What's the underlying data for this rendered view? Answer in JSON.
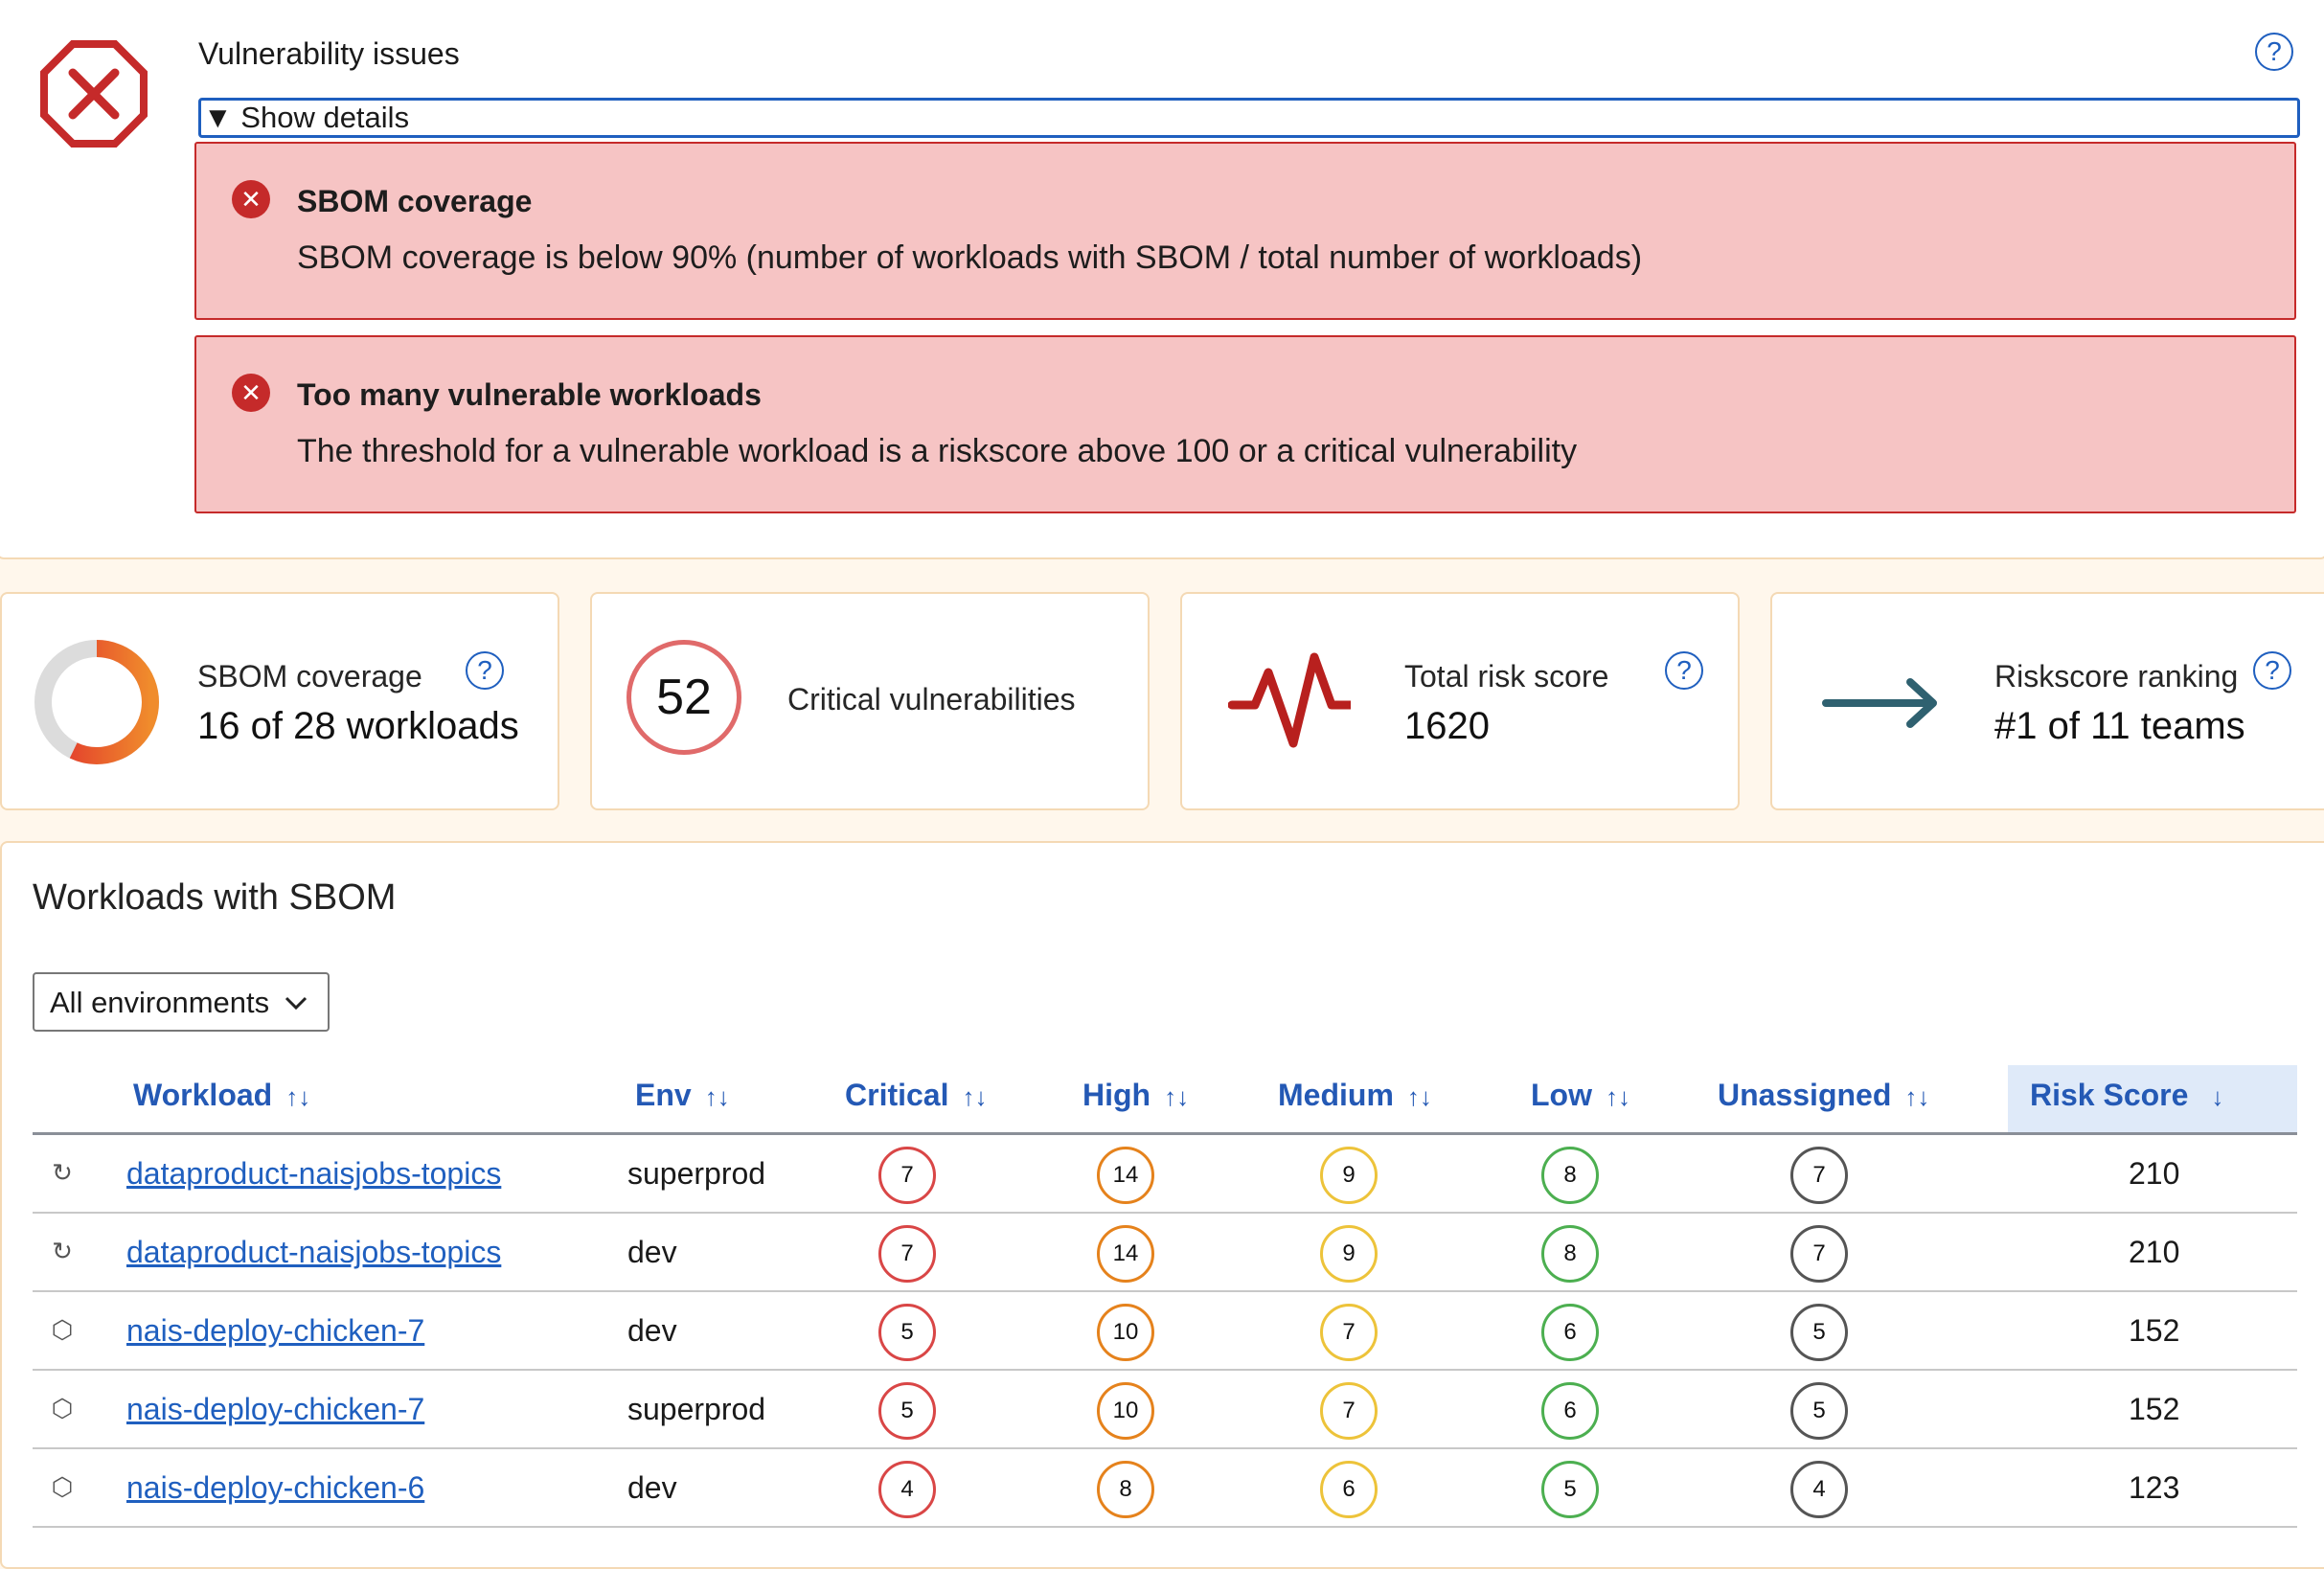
{
  "issues": {
    "title": "Vulnerability issues",
    "help": "?",
    "toggle_label": "▼ Show details",
    "items": [
      {
        "title": "SBOM coverage",
        "text": "SBOM coverage is below 90% (number of workloads with SBOM / total number of workloads)"
      },
      {
        "title": "Too many vulnerable workloads",
        "text": "The threshold for a vulnerable workload is a riskscore above 100 or a critical vulnerability"
      }
    ]
  },
  "stats": {
    "sbom": {
      "label": "SBOM coverage",
      "value": "16 of 28 workloads",
      "coverage_fraction": 0.571
    },
    "critical": {
      "number": "52",
      "label": "Critical vulnerabilities"
    },
    "risk": {
      "label": "Total risk score",
      "value": "1620"
    },
    "ranking": {
      "label": "Riskscore ranking",
      "value": "#1 of 11 teams"
    }
  },
  "workloads": {
    "title": "Workloads with SBOM",
    "env_select": "All environments",
    "columns": [
      "Workload",
      "Env",
      "Critical",
      "High",
      "Medium",
      "Low",
      "Unassigned",
      "Risk Score"
    ],
    "sort_icon": "↑↓",
    "sorted_icon": "↓",
    "rows": [
      {
        "icon": "refresh-icon",
        "workload": "dataproduct-naisjobs-topics",
        "env": "superprod",
        "critical": "7",
        "high": "14",
        "medium": "9",
        "low": "8",
        "unassigned": "7",
        "risk": "210"
      },
      {
        "icon": "refresh-icon",
        "workload": "dataproduct-naisjobs-topics",
        "env": "dev",
        "critical": "7",
        "high": "14",
        "medium": "9",
        "low": "8",
        "unassigned": "7",
        "risk": "210"
      },
      {
        "icon": "package-icon",
        "workload": "nais-deploy-chicken-7",
        "env": "dev",
        "critical": "5",
        "high": "10",
        "medium": "7",
        "low": "6",
        "unassigned": "5",
        "risk": "152"
      },
      {
        "icon": "package-icon",
        "workload": "nais-deploy-chicken-7",
        "env": "superprod",
        "critical": "5",
        "high": "10",
        "medium": "7",
        "low": "6",
        "unassigned": "5",
        "risk": "152"
      },
      {
        "icon": "package-icon",
        "workload": "nais-deploy-chicken-6",
        "env": "dev",
        "critical": "4",
        "high": "8",
        "medium": "6",
        "low": "5",
        "unassigned": "4",
        "risk": "123"
      }
    ]
  },
  "colors": {
    "error": "#c52a2a",
    "error_bg": "#f6c4c4",
    "link": "#1f5fbf",
    "critical": "#d94646",
    "high": "#e5821c",
    "medium": "#edc33a",
    "low": "#4caf50",
    "unassigned": "#555555"
  }
}
